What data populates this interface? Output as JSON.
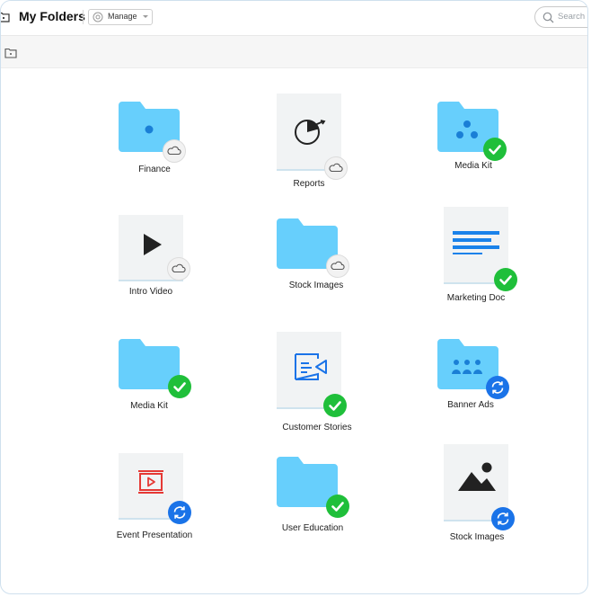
{
  "header": {
    "title": "My Folders",
    "manage_label": "Manage",
    "search_placeholder": "Search"
  },
  "colors": {
    "folder": "#67cffc",
    "folder_dot": "#1a7fd6",
    "synced": "#1fbf3a",
    "syncing": "#1a73e8",
    "doc_bg": "#f1f3f4"
  },
  "items": [
    {
      "name": "Finance",
      "kind": "folder",
      "glyph": "dot-icon",
      "status": "cloud"
    },
    {
      "name": "Reports",
      "kind": "document",
      "glyph": "pie-chart-icon",
      "status": "cloud"
    },
    {
      "name": "Media Kit",
      "kind": "folder",
      "glyph": "three-dots-icon",
      "status": "synced"
    },
    {
      "name": "Intro Video",
      "kind": "document",
      "glyph": "play-icon",
      "status": "cloud"
    },
    {
      "name": "Stock Images",
      "kind": "folder",
      "glyph": "none",
      "status": "cloud"
    },
    {
      "name": "Marketing Doc",
      "kind": "document",
      "glyph": "text-lines-icon",
      "status": "synced"
    },
    {
      "name": "Media Kit",
      "kind": "folder",
      "glyph": "none",
      "status": "synced"
    },
    {
      "name": "Customer Stories",
      "kind": "document",
      "glyph": "presentation-icon",
      "status": "synced"
    },
    {
      "name": "Banner Ads",
      "kind": "folder",
      "glyph": "people-icon",
      "status": "syncing"
    },
    {
      "name": "Event Presentation",
      "kind": "document",
      "glyph": "slideshow-icon",
      "status": "syncing"
    },
    {
      "name": "User Education",
      "kind": "folder",
      "glyph": "none",
      "status": "synced"
    },
    {
      "name": "Stock Images",
      "kind": "document",
      "glyph": "image-icon",
      "status": "syncing"
    }
  ]
}
